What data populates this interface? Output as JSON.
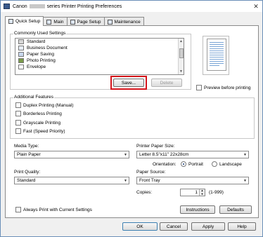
{
  "window": {
    "title_prefix": "Canon",
    "title_suffix": "series Printer Printing Preferences",
    "close": "✕"
  },
  "tabs": [
    {
      "label": "Quick Setup",
      "icon": "quick-setup-icon"
    },
    {
      "label": "Main",
      "icon": "main-icon"
    },
    {
      "label": "Page Setup",
      "icon": "page-setup-icon"
    },
    {
      "label": "Maintenance",
      "icon": "maintenance-icon"
    }
  ],
  "commonly_used": {
    "label": "Commonly Used Settings",
    "items": [
      {
        "label": "Standard",
        "icon": "standard-icon",
        "color": "#d8d8d8"
      },
      {
        "label": "Business Document",
        "icon": "document-icon",
        "color": "#e8eef7"
      },
      {
        "label": "Paper Saving",
        "icon": "paper-saving-icon",
        "color": "#c9d8ee"
      },
      {
        "label": "Photo Printing",
        "icon": "photo-icon",
        "color": "#7a9b4a"
      },
      {
        "label": "Envelope",
        "icon": "envelope-icon",
        "color": "#ffffff"
      }
    ],
    "save_label": "Save...",
    "delete_label": "Delete"
  },
  "preview": {
    "label": "Preview before printing"
  },
  "additional_features": {
    "label": "Additional Features",
    "items": [
      "Duplex Printing (Manual)",
      "Borderless Printing",
      "Grayscale Printing",
      "Fast (Speed Priority)"
    ]
  },
  "media_type": {
    "label": "Media Type:",
    "value": "Plain Paper"
  },
  "printer_paper_size": {
    "label": "Printer Paper Size:",
    "value": "Letter 8.5\"x11\" 22x28cm"
  },
  "orientation": {
    "label": "Orientation:",
    "portrait": "Portrait",
    "landscape": "Landscape"
  },
  "print_quality": {
    "label": "Print Quality:",
    "value": "Standard"
  },
  "paper_source": {
    "label": "Paper Source:",
    "value": "Front Tray"
  },
  "copies": {
    "label": "Copies:",
    "value": "1",
    "range": "(1-999)"
  },
  "always_print": {
    "label": "Always Print with Current Settings"
  },
  "buttons": {
    "instructions": "Instructions",
    "defaults": "Defaults",
    "ok": "OK",
    "cancel": "Cancel",
    "apply": "Apply",
    "help": "Help"
  },
  "colors": {
    "highlight": "#d4141b",
    "accent": "#1a3e7a"
  }
}
